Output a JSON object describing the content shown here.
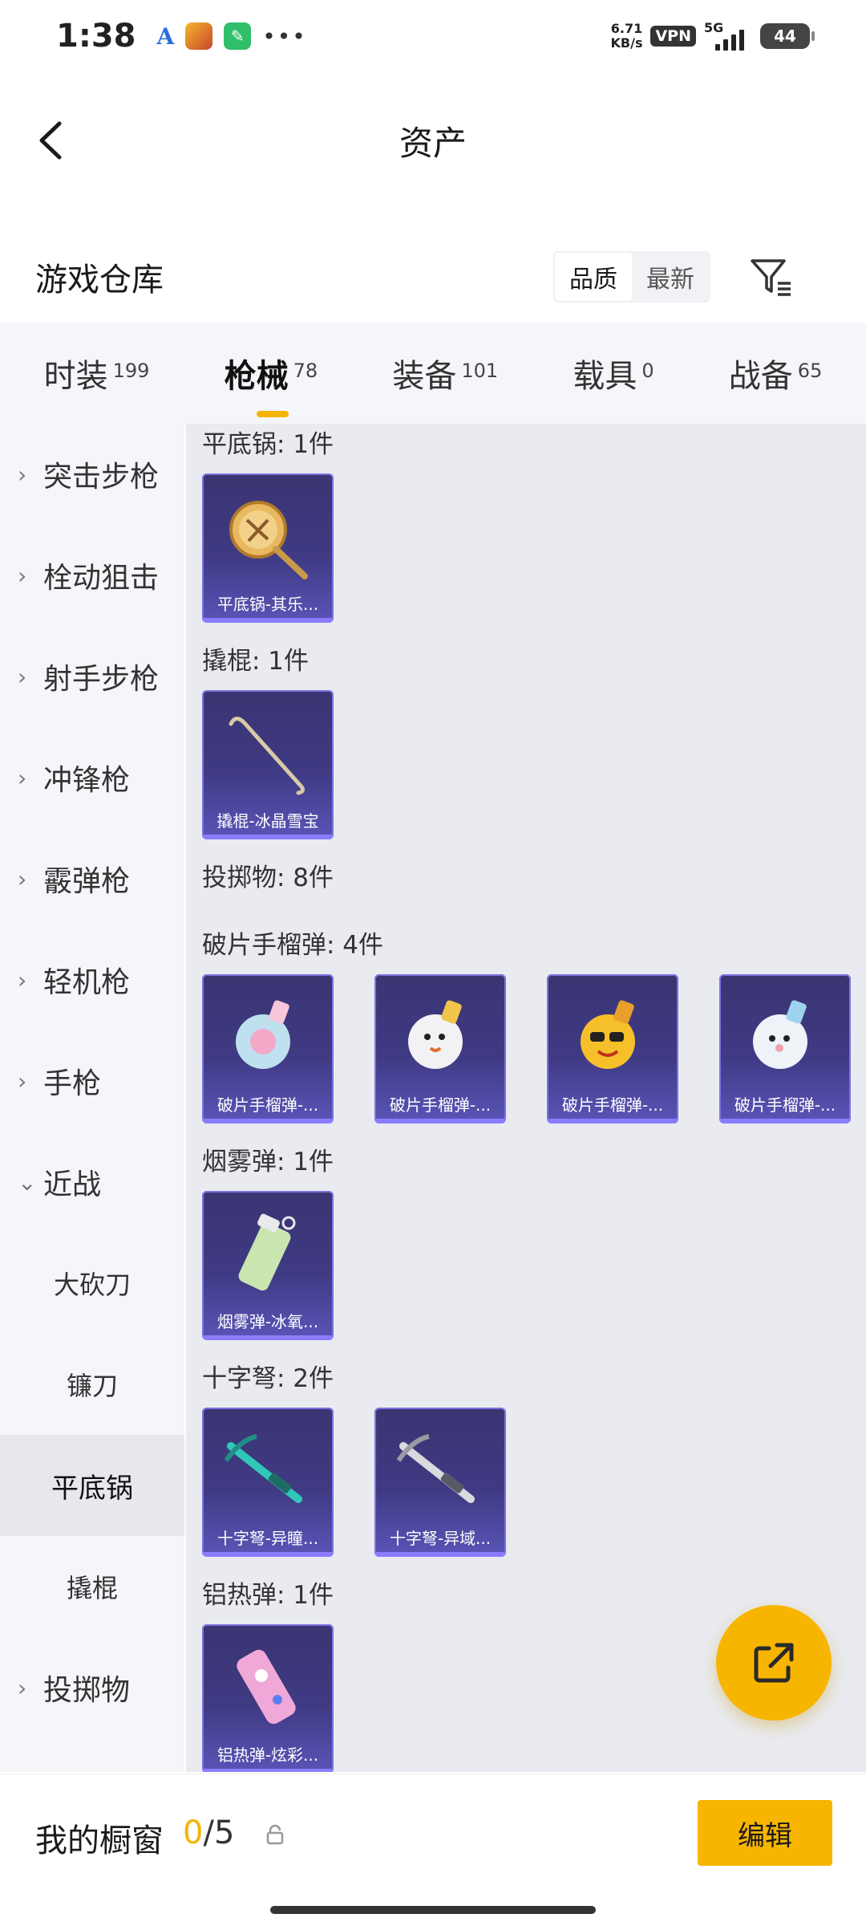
{
  "status_bar": {
    "time": "1:38",
    "net_speed_value": "6.71",
    "net_speed_unit": "KB/s",
    "vpn": "VPN",
    "network": "5G",
    "battery": "44"
  },
  "header": {
    "title": "资产"
  },
  "warehouse": {
    "title": "游戏仓库",
    "sort_quality": "品质",
    "sort_newest": "最新"
  },
  "tabs": [
    {
      "label": "时装",
      "count": "199"
    },
    {
      "label": "枪械",
      "count": "78"
    },
    {
      "label": "装备",
      "count": "101"
    },
    {
      "label": "载具",
      "count": "0"
    },
    {
      "label": "战备",
      "count": "65"
    }
  ],
  "sidebar": {
    "items": [
      {
        "label": "突击步枪"
      },
      {
        "label": "栓动狙击"
      },
      {
        "label": "射手步枪"
      },
      {
        "label": "冲锋枪"
      },
      {
        "label": "霰弹枪"
      },
      {
        "label": "轻机枪"
      },
      {
        "label": "手枪"
      },
      {
        "label": "近战"
      }
    ],
    "sub_items": [
      {
        "label": "大砍刀"
      },
      {
        "label": "镰刀"
      },
      {
        "label": "平底锅"
      },
      {
        "label": "撬棍"
      }
    ],
    "last_item": {
      "label": "投掷物"
    }
  },
  "content": {
    "sections": [
      {
        "title": "平底锅: 1件",
        "items": [
          "平底锅-其乐..."
        ]
      },
      {
        "title": "撬棍: 1件",
        "items": [
          "撬棍-冰晶雪宝"
        ]
      },
      {
        "title": "投掷物: 8件",
        "items": []
      },
      {
        "title": "破片手榴弹: 4件",
        "items": [
          "破片手榴弹-...",
          "破片手榴弹-...",
          "破片手榴弹-...",
          "破片手榴弹-..."
        ]
      },
      {
        "title": "烟雾弹: 1件",
        "items": [
          "烟雾弹-冰氧..."
        ]
      },
      {
        "title": "十字弩: 2件",
        "items": [
          "十字弩-异瞳...",
          "十字弩-异域..."
        ]
      },
      {
        "title": "铝热弹: 1件",
        "items": [
          "铝热弹-炫彩..."
        ]
      }
    ]
  },
  "bottom_bar": {
    "label": "我的橱窗",
    "current": "0",
    "separator": "/",
    "total": "5",
    "edit_label": "编辑"
  },
  "colors": {
    "accent": "#f7b500",
    "card_bg": "#3f3a83",
    "content_bg": "#e9ebf0",
    "sidebar_bg": "#f4f6fa"
  }
}
